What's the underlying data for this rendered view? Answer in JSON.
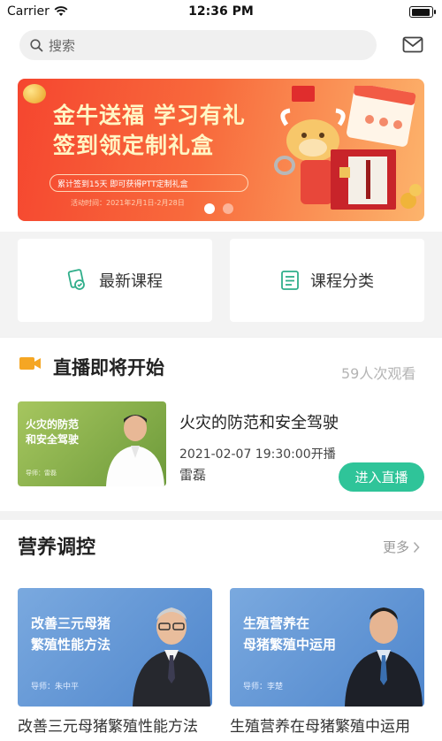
{
  "status_bar": {
    "carrier": "Carrier",
    "time": "12:36 PM"
  },
  "search": {
    "placeholder": "搜索"
  },
  "banner": {
    "title_line1": "金牛送福 学习有礼",
    "title_line2": "签到领定制礼盒",
    "pill_text": "累计签到15天 即可获得PTT定制礼盒",
    "sub_text": "活动时间：2021年2月1日-2月28日"
  },
  "quick_links": [
    {
      "label": "最新课程",
      "icon": "new-course-icon"
    },
    {
      "label": "课程分类",
      "icon": "category-list-icon"
    }
  ],
  "live": {
    "section_title": "直播即将开始",
    "viewers": "59人次观看",
    "thumb_line1": "火灾的防范",
    "thumb_line2": "和安全驾驶",
    "thumb_teacher": "导师：雷磊",
    "course_title": "火灾的防范和安全驾驶",
    "time": "2021-02-07 19:30:00开播",
    "teacher": "雷磊",
    "enter_label": "进入直播"
  },
  "nutrition": {
    "section_title": "营养调控",
    "more_label": "更多",
    "cards": [
      {
        "line1": "改善三元母猪",
        "line2": "繁殖性能方法",
        "teacher": "导师：朱中平",
        "caption": "改善三元母猪繁殖性能方法"
      },
      {
        "line1": "生殖营养在",
        "line2": "母猪繁殖中运用",
        "teacher": "导师：李楚",
        "caption": "生殖营养在母猪繁殖中运用"
      }
    ]
  },
  "colors": {
    "accent_green": "#2fc499",
    "banner_red": "#f5462f",
    "live_icon": "#f5a623"
  }
}
